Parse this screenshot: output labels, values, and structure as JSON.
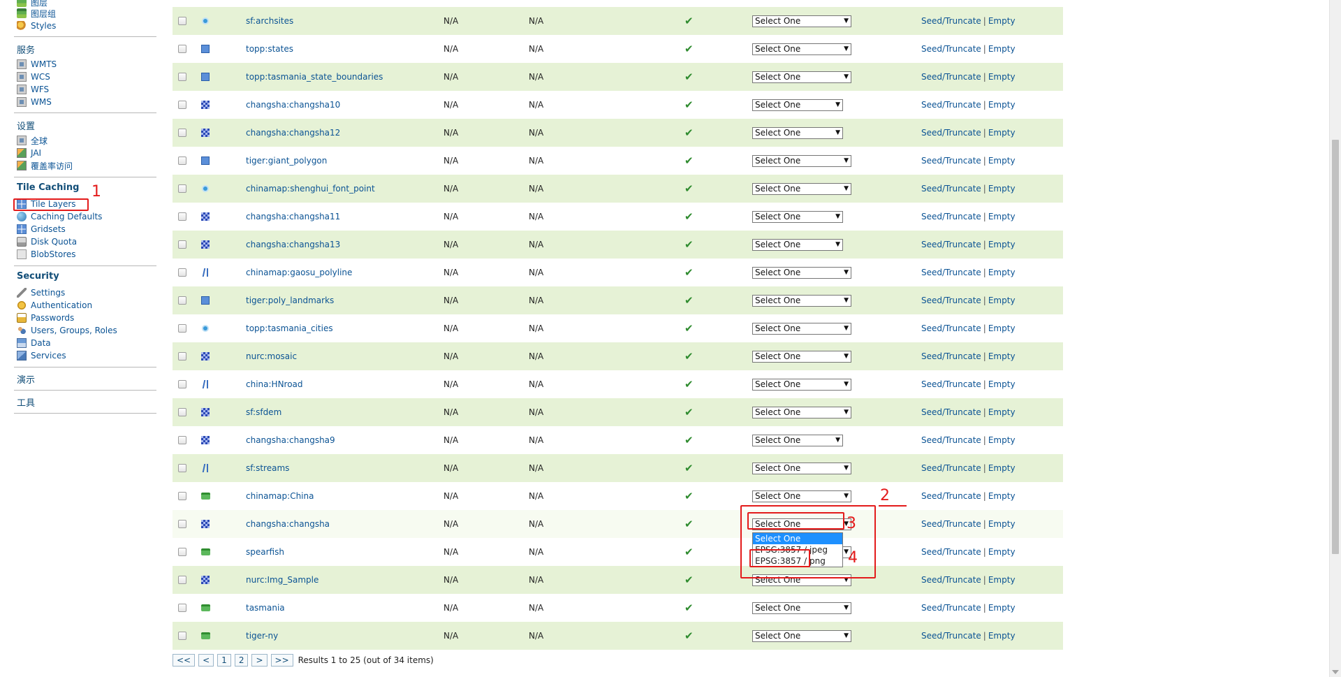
{
  "sidebar": {
    "data_items": [
      {
        "label": "图层",
        "icon": "layer-icon"
      },
      {
        "label": "图层组",
        "icon": "layer-group-icon"
      },
      {
        "label": "Styles",
        "icon": "styles-icon"
      }
    ],
    "sections": {
      "services": {
        "title": "服务",
        "items": [
          {
            "label": "WMTS",
            "icon": "service-icon"
          },
          {
            "label": "WCS",
            "icon": "service-icon"
          },
          {
            "label": "WFS",
            "icon": "service-icon"
          },
          {
            "label": "WMS",
            "icon": "service-icon"
          }
        ]
      },
      "settings": {
        "title": "设置",
        "items": [
          {
            "label": "全球",
            "icon": "globe-icon"
          },
          {
            "label": "JAI",
            "icon": "image-icon"
          },
          {
            "label": "覆盖率访问",
            "icon": "coverage-icon"
          }
        ]
      },
      "tile_caching": {
        "title": "Tile Caching",
        "items": [
          {
            "label": "Tile Layers",
            "icon": "tile-layers-icon"
          },
          {
            "label": "Caching Defaults",
            "icon": "globe-icon"
          },
          {
            "label": "Gridsets",
            "icon": "gridsets-icon"
          },
          {
            "label": "Disk Quota",
            "icon": "disk-icon"
          },
          {
            "label": "BlobStores",
            "icon": "blobstore-icon"
          }
        ]
      },
      "security": {
        "title": "Security",
        "items": [
          {
            "label": "Settings",
            "icon": "wrench-icon"
          },
          {
            "label": "Authentication",
            "icon": "auth-icon"
          },
          {
            "label": "Passwords",
            "icon": "lock-icon"
          },
          {
            "label": "Users, Groups, Roles",
            "icon": "users-icon"
          },
          {
            "label": "Data",
            "icon": "data-icon"
          },
          {
            "label": "Services",
            "icon": "services-icon"
          }
        ]
      },
      "demos": {
        "title": "演示"
      },
      "tools": {
        "title": "工具"
      }
    }
  },
  "table": {
    "rows": [
      {
        "name": "sf:archsites",
        "type": "point",
        "expires": "N/A",
        "expires2": "N/A",
        "enabled": "✔",
        "select": "Select One",
        "seed": "Seed/Truncate",
        "empty": "Empty"
      },
      {
        "name": "topp:states",
        "type": "polygon",
        "expires": "N/A",
        "expires2": "N/A",
        "enabled": "✔",
        "select": "Select One",
        "seed": "Seed/Truncate",
        "empty": "Empty"
      },
      {
        "name": "topp:tasmania_state_boundaries",
        "type": "polygon",
        "expires": "N/A",
        "expires2": "N/A",
        "enabled": "✔",
        "select": "Select One",
        "seed": "Seed/Truncate",
        "empty": "Empty"
      },
      {
        "name": "changsha:changsha10",
        "type": "raster",
        "expires": "N/A",
        "expires2": "N/A",
        "enabled": "✔",
        "select": "Select One",
        "seed": "Seed/Truncate",
        "empty": "Empty"
      },
      {
        "name": "changsha:changsha12",
        "type": "raster",
        "expires": "N/A",
        "expires2": "N/A",
        "enabled": "✔",
        "select": "Select One",
        "seed": "Seed/Truncate",
        "empty": "Empty"
      },
      {
        "name": "tiger:giant_polygon",
        "type": "polygon",
        "expires": "N/A",
        "expires2": "N/A",
        "enabled": "✔",
        "select": "Select One",
        "seed": "Seed/Truncate",
        "empty": "Empty"
      },
      {
        "name": "chinamap:shenghui_font_point",
        "type": "point",
        "expires": "N/A",
        "expires2": "N/A",
        "enabled": "✔",
        "select": "Select One",
        "seed": "Seed/Truncate",
        "empty": "Empty"
      },
      {
        "name": "changsha:changsha11",
        "type": "raster",
        "expires": "N/A",
        "expires2": "N/A",
        "enabled": "✔",
        "select": "Select One",
        "seed": "Seed/Truncate",
        "empty": "Empty"
      },
      {
        "name": "changsha:changsha13",
        "type": "raster",
        "expires": "N/A",
        "expires2": "N/A",
        "enabled": "✔",
        "select": "Select One",
        "seed": "Seed/Truncate",
        "empty": "Empty"
      },
      {
        "name": "chinamap:gaosu_polyline",
        "type": "line",
        "expires": "N/A",
        "expires2": "N/A",
        "enabled": "✔",
        "select": "Select One",
        "seed": "Seed/Truncate",
        "empty": "Empty"
      },
      {
        "name": "tiger:poly_landmarks",
        "type": "polygon",
        "expires": "N/A",
        "expires2": "N/A",
        "enabled": "✔",
        "select": "Select One",
        "seed": "Seed/Truncate",
        "empty": "Empty"
      },
      {
        "name": "topp:tasmania_cities",
        "type": "point",
        "expires": "N/A",
        "expires2": "N/A",
        "enabled": "✔",
        "select": "Select One",
        "seed": "Seed/Truncate",
        "empty": "Empty"
      },
      {
        "name": "nurc:mosaic",
        "type": "raster",
        "expires": "N/A",
        "expires2": "N/A",
        "enabled": "✔",
        "select": "Select One",
        "seed": "Seed/Truncate",
        "empty": "Empty"
      },
      {
        "name": "china:HNroad",
        "type": "line",
        "expires": "N/A",
        "expires2": "N/A",
        "enabled": "✔",
        "select": "Select One",
        "seed": "Seed/Truncate",
        "empty": "Empty"
      },
      {
        "name": "sf:sfdem",
        "type": "raster",
        "expires": "N/A",
        "expires2": "N/A",
        "enabled": "✔",
        "select": "Select One",
        "seed": "Seed/Truncate",
        "empty": "Empty"
      },
      {
        "name": "changsha:changsha9",
        "type": "raster",
        "expires": "N/A",
        "expires2": "N/A",
        "enabled": "✔",
        "select": "Select One",
        "seed": "Seed/Truncate",
        "empty": "Empty"
      },
      {
        "name": "sf:streams",
        "type": "line",
        "expires": "N/A",
        "expires2": "N/A",
        "enabled": "✔",
        "select": "Select One",
        "seed": "Seed/Truncate",
        "empty": "Empty"
      },
      {
        "name": "chinamap:China",
        "type": "group",
        "expires": "N/A",
        "expires2": "N/A",
        "enabled": "✔",
        "select": "Select One",
        "seed": "Seed/Truncate",
        "empty": "Empty"
      },
      {
        "name": "changsha:changsha",
        "type": "raster",
        "expires": "N/A",
        "expires2": "N/A",
        "enabled": "✔",
        "select": "Select One",
        "seed": "Seed/Truncate",
        "empty": "Empty"
      },
      {
        "name": "spearfish",
        "type": "group",
        "expires": "N/A",
        "expires2": "N/A",
        "enabled": "✔",
        "select": "Select One",
        "seed": "Seed/Truncate",
        "empty": "Empty"
      },
      {
        "name": "nurc:Img_Sample",
        "type": "raster",
        "expires": "N/A",
        "expires2": "N/A",
        "enabled": "✔",
        "select": "Select One",
        "seed": "Seed/Truncate",
        "empty": "Empty"
      },
      {
        "name": "tasmania",
        "type": "group",
        "expires": "N/A",
        "expires2": "N/A",
        "enabled": "✔",
        "select": "Select One",
        "seed": "Seed/Truncate",
        "empty": "Empty"
      },
      {
        "name": "tiger-ny",
        "type": "group",
        "expires": "N/A",
        "expires2": "N/A",
        "enabled": "✔",
        "select": "Select One",
        "seed": "Seed/Truncate",
        "empty": "Empty"
      }
    ],
    "separator": "|"
  },
  "dropdown": {
    "options": [
      "Select One",
      "EPSG:3857 / jpeg",
      "EPSG:3857 / png"
    ],
    "highlighted": "Select One"
  },
  "pager": {
    "first": "<<",
    "prev": "<",
    "pages": [
      "1",
      "2"
    ],
    "next": ">",
    "last": ">>",
    "info": "Results 1 to 25 (out of 34 items)"
  },
  "annotations": [
    "1",
    "2",
    "3",
    "4"
  ],
  "colors": {
    "link": "#0b5394",
    "row_alt": "#e6f2d6",
    "check": "#2e8b2e",
    "annotation": "#e31b1b",
    "highlight": "#1e90ff"
  }
}
